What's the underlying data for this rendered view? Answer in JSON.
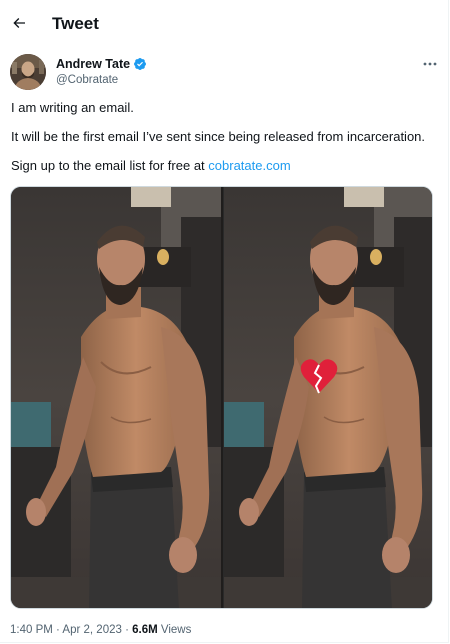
{
  "header": {
    "title": "Tweet",
    "back_icon": "arrow-left-icon"
  },
  "author": {
    "display_name": "Andrew Tate",
    "handle": "@Cobratate",
    "verified": true,
    "verified_color": "#1d9bf0"
  },
  "tweet": {
    "line1": "I am writing an email.",
    "line2": "It will be the first email I’ve sent since being released from incarceration.",
    "line3_prefix": "Sign up to the email list for free at ",
    "link_text": "cobratate.com",
    "link_color": "#1d9bf0"
  },
  "media": {
    "overlay_icon": "broken-heart-icon"
  },
  "meta": {
    "time": "1:40 PM",
    "separator": " · ",
    "date": "Apr 2, 2023",
    "views_count": "6.6M",
    "views_label": " Views"
  }
}
